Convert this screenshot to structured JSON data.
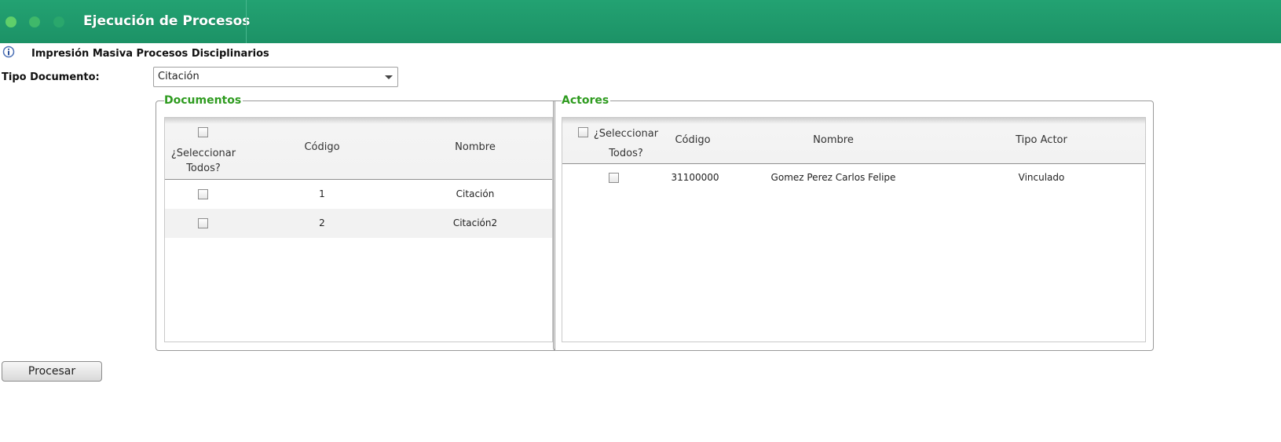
{
  "header": {
    "title": "Ejecución de Procesos"
  },
  "section": {
    "title": "Impresión Masiva Procesos Disciplinarios",
    "info_icon": "info-icon"
  },
  "form": {
    "tipo_documento_label": "Tipo Documento:",
    "tipo_documento_value": "Citación"
  },
  "documentos": {
    "legend": "Documentos",
    "columns": {
      "select_all": "¿Seleccionar Todos?",
      "codigo": "Código",
      "nombre": "Nombre"
    },
    "rows": [
      {
        "codigo": "1",
        "nombre": "Citación",
        "checked": false
      },
      {
        "codigo": "2",
        "nombre": "Citación2",
        "checked": false
      }
    ]
  },
  "actores": {
    "legend": "Actores",
    "columns": {
      "select_all": "¿Seleccionar Todos?",
      "codigo": "Código",
      "nombre": "Nombre",
      "tipo_actor": "Tipo Actor"
    },
    "rows": [
      {
        "codigo": "31100000",
        "nombre": "Gomez Perez Carlos Felipe",
        "tipo_actor": "Vinculado",
        "checked": false
      }
    ]
  },
  "actions": {
    "procesar_label": "Procesar"
  },
  "colors": {
    "header_bg": "#1f9a6b",
    "legend_text": "#2e9b1f"
  }
}
